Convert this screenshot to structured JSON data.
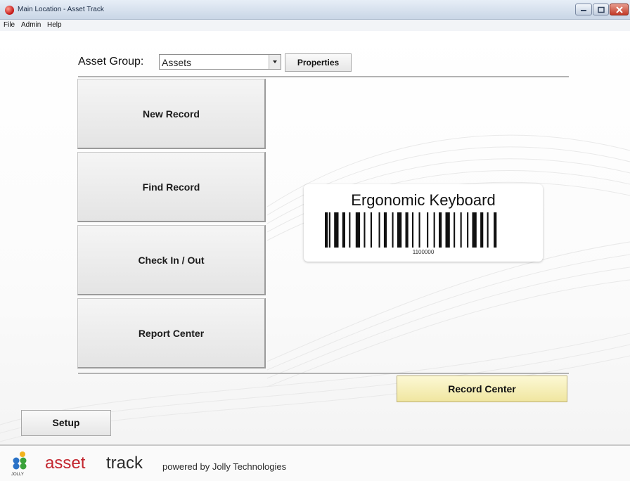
{
  "window": {
    "title": "Main Location - Asset Track"
  },
  "menu": {
    "items": [
      "File",
      "Admin",
      "Help"
    ]
  },
  "asset_group": {
    "label": "Asset Group:",
    "selected": "Assets"
  },
  "buttons": {
    "properties": "Properties",
    "new_record": "New Record",
    "find_record": "Find Record",
    "check_in_out": "Check In / Out",
    "report_center": "Report Center",
    "record_center": "Record Center",
    "setup": "Setup"
  },
  "label_preview": {
    "title": "Ergonomic Keyboard",
    "barcode_number": "1100000"
  },
  "footer": {
    "logo_small": "JOLLY",
    "logo_asset": "asset",
    "logo_track": "track",
    "powered_by": "powered by Jolly Technologies"
  },
  "colors": {
    "record_center_bg": "#f6efb7",
    "logo_asset": "#c3252e"
  }
}
